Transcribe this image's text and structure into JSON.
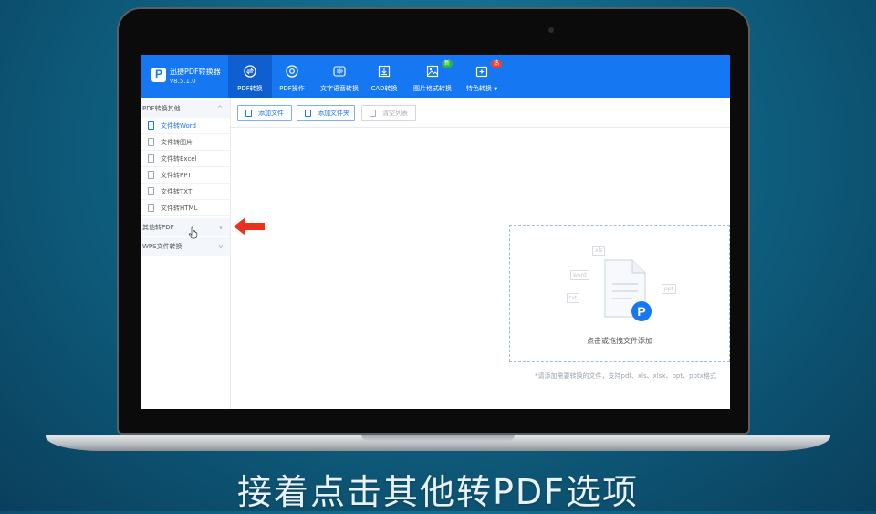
{
  "app": {
    "title": "迅捷PDF转换器",
    "version": "v8.5.1.0"
  },
  "nav": {
    "tabs": [
      {
        "label": "PDF转换",
        "icon": "convert-icon"
      },
      {
        "label": "PDF操作",
        "icon": "disc-icon"
      },
      {
        "label": "文字语音转换",
        "icon": "audio-wave-icon"
      },
      {
        "label": "CAD转换",
        "icon": "download-box-icon"
      },
      {
        "label": "图片格式转换",
        "icon": "image-icon",
        "badge": "新"
      },
      {
        "label": "特色转换",
        "icon": "sparkle-box-icon",
        "badge": "热"
      }
    ],
    "dropdown_arrow": "▼"
  },
  "sidebar": {
    "groups": [
      {
        "label": "PDF转换其他",
        "items": [
          "文件转Word",
          "文件转图片",
          "文件转Excel",
          "文件转PPT",
          "文件转TXT",
          "文件转HTML"
        ]
      },
      {
        "label": "其他转PDF",
        "items": []
      },
      {
        "label": "WPS文件转换",
        "items": []
      }
    ],
    "chevron_up": "^",
    "chevron_down": "v"
  },
  "toolbar": {
    "add_file": "添加文件",
    "add_folder": "添加文件夹",
    "clear_list": "清空列表"
  },
  "drop_zone": {
    "text": "点击或拖拽文件添加",
    "tags": [
      "xls",
      "word",
      "ppt",
      "txt"
    ],
    "hint": "*请添加需要转换的文件，支持pdf、xls、xlsx、ppt、pptx格式"
  },
  "caption": "接着点击其他转PDF选项",
  "colors": {
    "brand": "#1677f2",
    "badge_new": "#2fb344",
    "badge_hot": "#f0402b",
    "arrow": "#e8321e"
  }
}
